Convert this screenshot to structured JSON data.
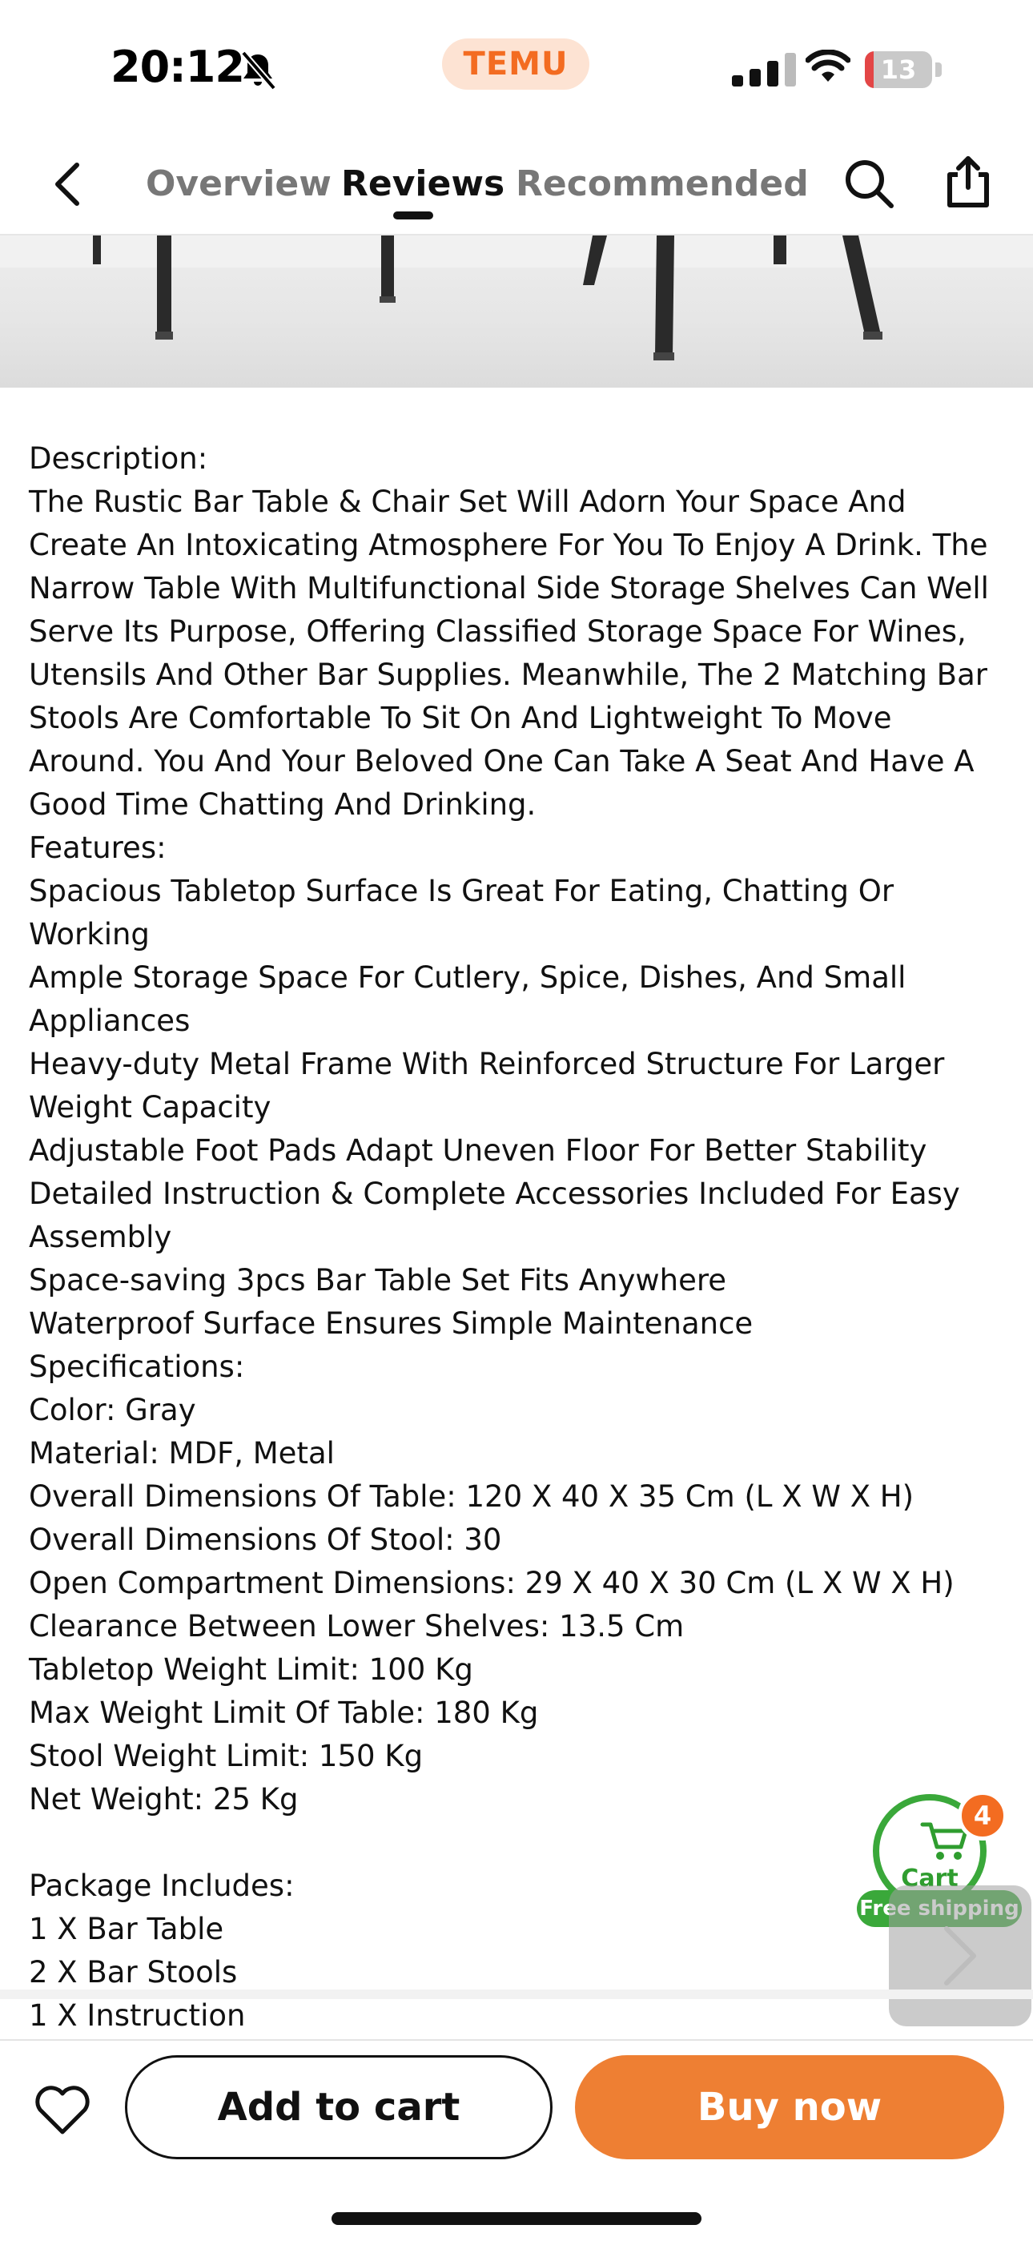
{
  "status_bar": {
    "time": "20:12",
    "brand": "TEMU",
    "battery": "13",
    "battery_level_pct": 13
  },
  "nav": {
    "tabs": [
      {
        "label": "Overview",
        "active": false
      },
      {
        "label": "Reviews",
        "active": true
      },
      {
        "label": "Recommended",
        "active": false
      }
    ]
  },
  "description": {
    "lines": [
      "Description:",
      "The Rustic Bar Table & Chair Set Will Adorn Your Space And Create An Intoxicating Atmosphere For You To Enjoy A Drink. The Narrow Table With Multifunctional Side Storage Shelves Can Well Serve Its Purpose, Offering Classified Storage Space For Wines, Utensils And Other Bar Supplies. Meanwhile, The 2 Matching Bar Stools Are Comfortable To Sit On And Lightweight To Move Around. You And Your Beloved One Can Take A Seat And Have A Good Time Chatting And Drinking.",
      "Features:",
      "Spacious Tabletop Surface Is Great For Eating, Chatting Or Working",
      "Ample Storage Space For Cutlery, Spice, Dishes, And Small Appliances",
      "Heavy-duty Metal Frame With Reinforced Structure For Larger Weight Capacity",
      "Adjustable Foot Pads Adapt Uneven Floor For Better Stability",
      "Detailed Instruction & Complete Accessories Included For Easy Assembly",
      "Space-saving 3pcs Bar Table Set Fits Anywhere",
      "Waterproof Surface Ensures Simple Maintenance",
      "Specifications:",
      "Color: Gray",
      "Material: MDF, Metal",
      "Overall Dimensions Of Table: 120 X 40 X 35 Cm (L X W X H)",
      "Overall Dimensions Of Stool: 30",
      "Open Compartment Dimensions: 29 X 40 X 30 Cm (L X W X H)",
      "Clearance Between Lower Shelves: 13.5 Cm",
      "Tabletop Weight Limit: 100 Kg",
      "Max Weight Limit Of Table: 180 Kg",
      "Stool Weight Limit: 150 Kg",
      "Net Weight: 25 Kg",
      "",
      "Package Includes:",
      "1 X Bar Table",
      "2 X Bar Stools",
      "1 X Instruction"
    ]
  },
  "cart_float": {
    "label": "Cart",
    "badge": "4",
    "shipping": "Free shipping"
  },
  "bottom_bar": {
    "add_to_cart": "Add to cart",
    "buy_now": "Buy now"
  },
  "colors": {
    "brand_orange": "#f36c21",
    "buy_button": "#ee7f33",
    "cart_green": "#3aa83a"
  },
  "icons": [
    "bell-slash-icon",
    "signal-icon",
    "wifi-icon",
    "battery-icon",
    "back-chevron-icon",
    "search-icon",
    "share-icon",
    "cart-icon",
    "chevron-right-icon",
    "heart-icon"
  ]
}
